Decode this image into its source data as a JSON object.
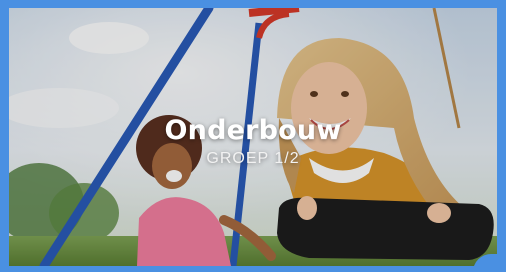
{
  "card": {
    "title": "Onderbouw",
    "subtitle": "GROEP 1/2",
    "border_color": "#4a90e2",
    "image_description": "children-on-swing-photo"
  }
}
